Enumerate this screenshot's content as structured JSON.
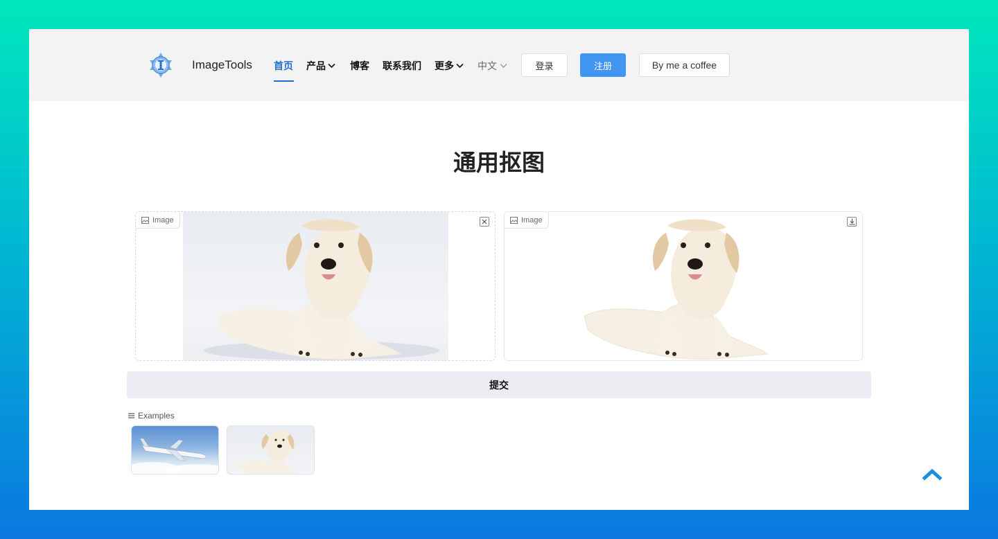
{
  "header": {
    "brand": "ImageTools",
    "nav": [
      {
        "label": "首页",
        "active": true
      },
      {
        "label": "产品",
        "dropdown": true
      },
      {
        "label": "博客"
      },
      {
        "label": "联系我们"
      },
      {
        "label": "更多",
        "dropdown": true
      }
    ],
    "language": "中文",
    "login_label": "登录",
    "register_label": "注册",
    "coffee_label": "By me a coffee"
  },
  "main": {
    "title": "通用抠图",
    "input_panel": {
      "label": "Image"
    },
    "output_panel": {
      "label": "Image"
    },
    "submit_label": "提交",
    "examples_label": "Examples",
    "examples": [
      {
        "subject": "airplane"
      },
      {
        "subject": "dog"
      }
    ]
  },
  "colors": {
    "accent": "#1e6fd0",
    "primary_button": "#4096f0",
    "scroll_top": "#1a8fe0"
  }
}
